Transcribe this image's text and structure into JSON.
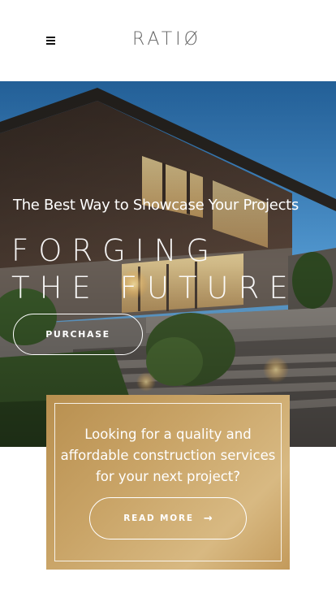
{
  "header": {
    "logo": "RATIØ",
    "menu_icon": "hamburger-menu-icon"
  },
  "hero": {
    "tagline": "The Best Way to Showcase Your Projects",
    "title": "FORGING THE FUTURE",
    "purchase_label": "PURCHASE"
  },
  "promo": {
    "text": "Looking for a quality and affordable construction services for your next project?",
    "read_more_label": "READ MORE",
    "arrow_icon": "arrow-right-icon"
  },
  "colors": {
    "gold_accent": "#c9a467",
    "header_bg": "#ffffff",
    "text_on_image": "#ffffff"
  }
}
